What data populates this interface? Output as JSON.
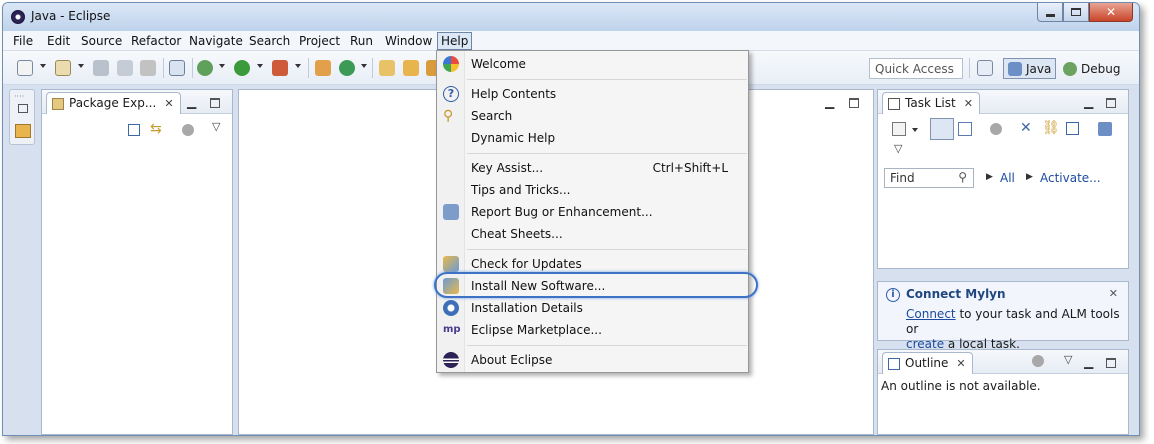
{
  "window": {
    "title": "Java - Eclipse"
  },
  "menubar": [
    "File",
    "Edit",
    "Source",
    "Refactor",
    "Navigate",
    "Search",
    "Project",
    "Run",
    "Window",
    "Help"
  ],
  "toolbar": {
    "quick_access_placeholder": "Quick Access",
    "perspectives": {
      "java": "Java",
      "debug": "Debug"
    }
  },
  "package_explorer": {
    "tab_label": "Package Exp..."
  },
  "task_list": {
    "tab_label": "Task List",
    "find_placeholder": "Find",
    "all_link": "All",
    "activate_link": "Activate..."
  },
  "mylyn": {
    "title": "Connect Mylyn",
    "connect_link": "Connect",
    "text1": " to your task and ALM tools or",
    "create_link": "create",
    "text2": " a local task."
  },
  "outline": {
    "tab_label": "Outline",
    "empty_text": "An outline is not available."
  },
  "help_menu": {
    "items": [
      {
        "label": "Welcome",
        "icon": "welcome-icon"
      },
      {
        "label": "Help Contents",
        "icon": "help-contents-icon"
      },
      {
        "label": "Search",
        "icon": "search-help-icon"
      },
      {
        "label": "Dynamic Help",
        "icon": ""
      },
      {
        "label": "Key Assist...",
        "accel": "Ctrl+Shift+L"
      },
      {
        "label": "Tips and Tricks..."
      },
      {
        "label": "Report Bug or Enhancement...",
        "icon": "report-bug-icon"
      },
      {
        "label": "Cheat Sheets..."
      },
      {
        "label": "Check for Updates",
        "icon": "check-updates-icon"
      },
      {
        "label": "Install New Software...",
        "icon": "install-software-icon"
      },
      {
        "label": "Installation Details",
        "icon": "installation-details-icon"
      },
      {
        "label": "Eclipse Marketplace...",
        "icon": "marketplace-icon",
        "icon_text": "mp"
      },
      {
        "label": "About Eclipse",
        "icon": "eclipse-icon"
      }
    ]
  },
  "colors": {
    "accent": "#3d72c4",
    "link": "#1c4a9e"
  }
}
